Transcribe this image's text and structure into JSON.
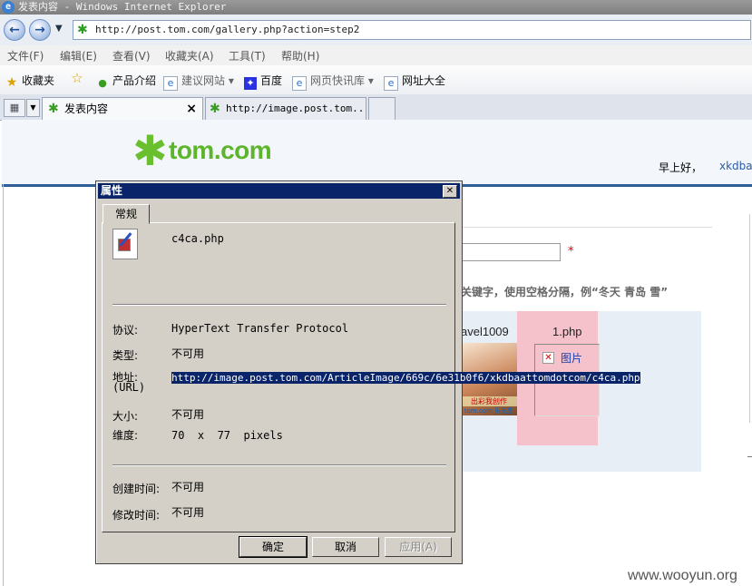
{
  "window": {
    "title": "发表内容 - Windows Internet Explorer"
  },
  "address": {
    "url": "http://post.tom.com/gallery.php?action=step2"
  },
  "menu": [
    "文件(F)",
    "编辑(E)",
    "查看(V)",
    "收藏夹(A)",
    "工具(T)",
    "帮助(H)"
  ],
  "favorites": {
    "label": "收藏夹",
    "items": [
      "产品介绍",
      "建议网站",
      "百度",
      "网页快讯库",
      "网址大全"
    ]
  },
  "tabs": [
    {
      "label": "发表内容",
      "close": "×"
    },
    {
      "label": "http://image.post.tom..."
    }
  ],
  "site": {
    "logo_text": "tom.com",
    "greeting": "早上好，",
    "username": "xkdba",
    "required_mark": "*",
    "keyword_hint": "关键字，使用空格分隔，例“冬天 青岛 雪”",
    "gallery_item_name": "avel1009",
    "thumb_caption": "出彩我创作",
    "thumb_caption2": "tom.com 乐先生",
    "php_item_name": "1.php",
    "broken_image_alt": "图片",
    "watermark": "www.wooyun.org"
  },
  "dialog": {
    "title": "属性",
    "close": "✕",
    "tab": "常规",
    "filename": "c4ca.php",
    "protocol_label": "协议:",
    "protocol_value": "HyperText Transfer Protocol",
    "type_label": "类型:",
    "type_value": "不可用",
    "address_label": "地址:",
    "address_label2": "(URL)",
    "address_value": "http://image.post.tom.com/ArticleImage/669c/6e31b0f6/xkdbaattomdotcom/c4ca.php",
    "size_label": "大小:",
    "size_value": "不可用",
    "dimensions_label": "维度:",
    "dimensions_value": "70  x  77  pixels",
    "created_label": "创建时间:",
    "created_value": "不可用",
    "modified_label": "修改时间:",
    "modified_value": "不可用",
    "buttons": {
      "ok": "确定",
      "cancel": "取消",
      "apply": "应用(A)"
    }
  }
}
